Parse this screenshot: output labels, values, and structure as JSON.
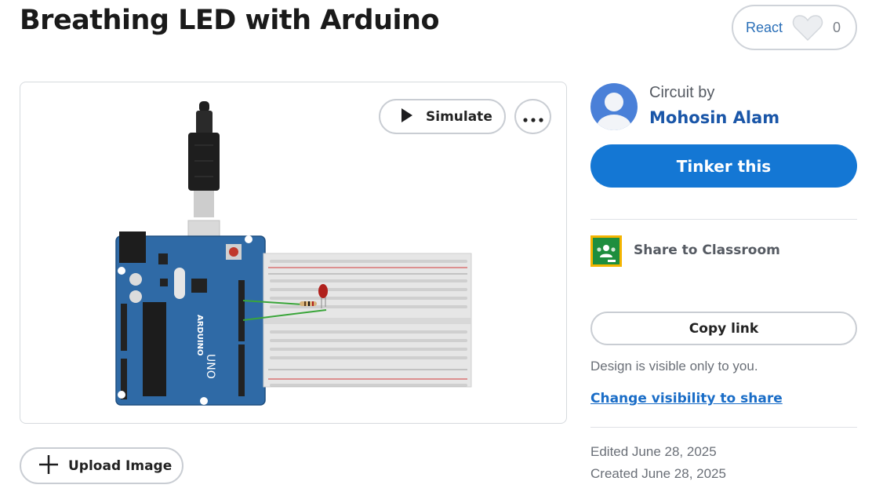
{
  "header": {
    "title": "Breathing LED with Arduino",
    "react_label": "React",
    "react_count": "0"
  },
  "canvas": {
    "simulate_label": "Simulate",
    "more_icon": "more-options-icon",
    "board_brand": "ARDUINO",
    "board_model": "UNO"
  },
  "upload": {
    "label": "Upload Image",
    "icon": "plus-icon"
  },
  "author": {
    "circuit_by_label": "Circuit by",
    "name": "Mohosin Alam"
  },
  "actions": {
    "tinker_label": "Tinker this",
    "classroom_label": "Share to Classroom",
    "copy_link_label": "Copy link"
  },
  "visibility": {
    "note": "Design is visible only to you.",
    "link": "Change visibility to share"
  },
  "dates": {
    "edited": "Edited June 28, 2025",
    "created": "Created June 28, 2025"
  },
  "colors": {
    "accent": "#1477d4",
    "link": "#1a56a8",
    "board": "#2f6aa6",
    "classroom_green": "#1e8e3e",
    "classroom_yellow": "#f4b400"
  }
}
